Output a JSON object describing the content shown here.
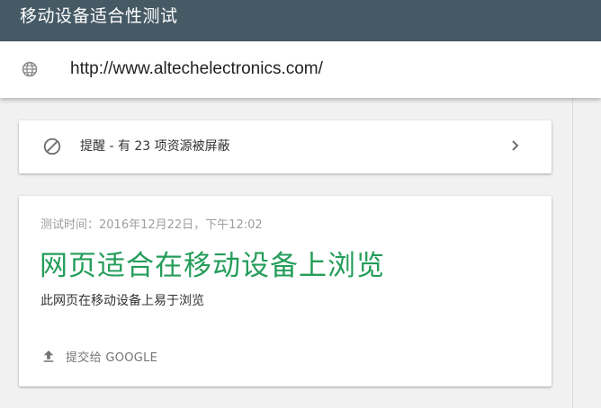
{
  "header": {
    "title": "移动设备适合性测试"
  },
  "url_bar": {
    "icon": "globe-icon",
    "url": "http://www.altechelectronics.com/"
  },
  "alert": {
    "icon": "block-icon",
    "label": "提醒 - 有 23 项资源被屏蔽",
    "chevron_icon": "chevron-right-icon"
  },
  "result": {
    "test_time": "测试时间：2016年12月22日，下午12:02",
    "verdict": "网页适合在移动设备上浏览",
    "verdict_color": "#249d5a",
    "subtitle": "此网页在移动设备上易于浏览",
    "submit_icon": "upload-icon",
    "submit_label": "提交给 GOOGLE"
  },
  "colors": {
    "header_bg": "#465a65",
    "page_bg": "#f1f1f1"
  }
}
